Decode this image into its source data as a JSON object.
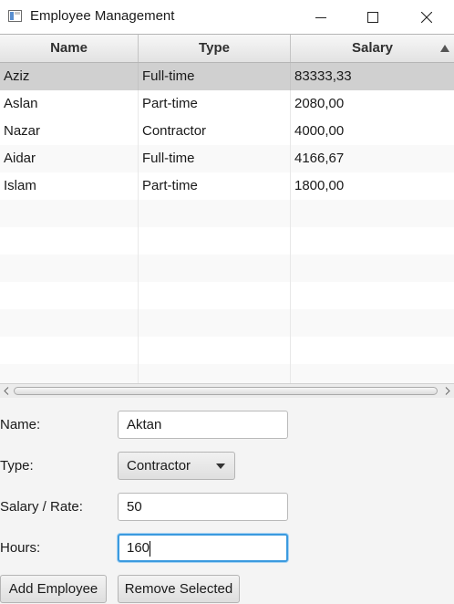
{
  "window": {
    "title": "Employee Management"
  },
  "table": {
    "columns": [
      "Name",
      "Type",
      "Salary"
    ],
    "sort": {
      "column": "Salary",
      "direction": "ascending"
    },
    "rows": [
      {
        "name": "Aziz",
        "type": "Full-time",
        "salary": "83333,33",
        "selected": true
      },
      {
        "name": "Aslan",
        "type": "Part-time",
        "salary": "2080,00"
      },
      {
        "name": "Nazar",
        "type": "Contractor",
        "salary": "4000,00"
      },
      {
        "name": "Aidar",
        "type": "Full-time",
        "salary": "4166,67"
      },
      {
        "name": "Islam",
        "type": "Part-time",
        "salary": "1800,00"
      }
    ],
    "empty_rows": 7
  },
  "form": {
    "name_label": "Name:",
    "name_value": "Aktan",
    "type_label": "Type:",
    "type_value": "Contractor",
    "salary_label": "Salary / Rate:",
    "salary_value": "50",
    "hours_label": "Hours:",
    "hours_value": "160"
  },
  "buttons": {
    "add": "Add Employee",
    "remove": "Remove Selected"
  },
  "icons": {
    "app": "app-window-icon",
    "minimize": "minimize-icon",
    "maximize": "maximize-icon",
    "close": "close-icon",
    "sort": "sort-ascending-icon",
    "combo": "chevron-down-icon"
  }
}
